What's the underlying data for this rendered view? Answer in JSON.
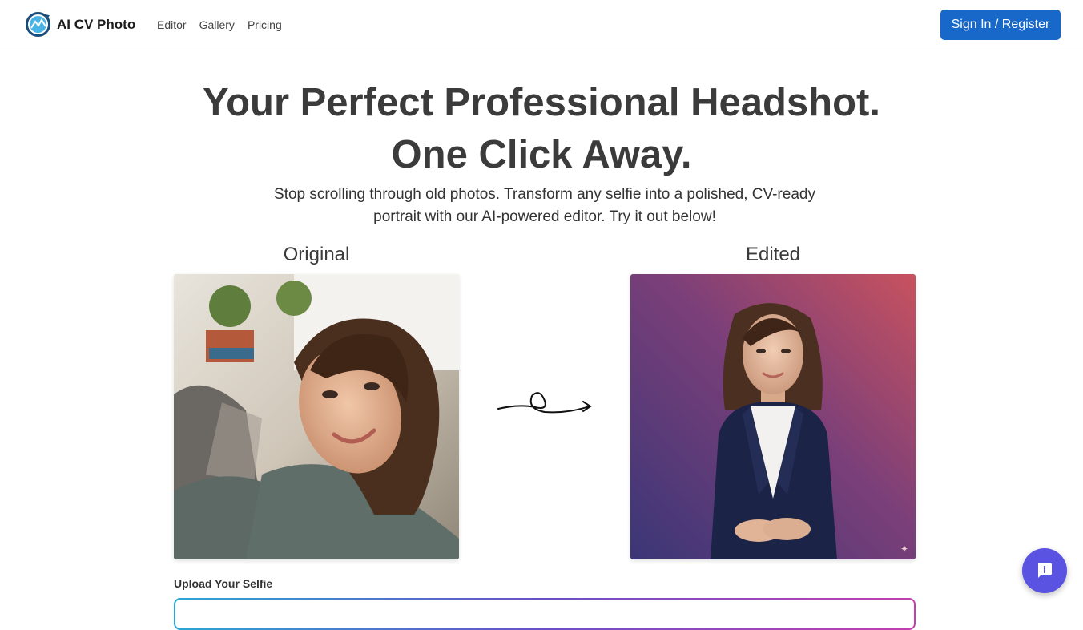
{
  "header": {
    "brand": "AI CV Photo",
    "logo_icon": "camera-refresh-logo-icon",
    "nav": [
      {
        "label": "Editor"
      },
      {
        "label": "Gallery"
      },
      {
        "label": "Pricing"
      }
    ],
    "signin_label": "Sign In / Register",
    "accent": "#1868c9"
  },
  "hero": {
    "title_line1": "Your Perfect Professional Headshot.",
    "title_line2": "One Click Away.",
    "subtitle_line1": "Stop scrolling through old photos. Transform any selfie into a polished, CV-ready",
    "subtitle_line2": "portrait with our AI-powered editor. Try it out below!"
  },
  "comparison": {
    "original_label": "Original",
    "edited_label": "Edited",
    "original_image": "casual selfie of smiling woman",
    "edited_image": "professional headshot of woman in navy blazer",
    "arrow_icon": "curly-arrow-icon"
  },
  "upload": {
    "label": "Upload Your Selfie"
  },
  "chat": {
    "icon": "chat-bubble-icon",
    "color": "#5a52e0"
  }
}
